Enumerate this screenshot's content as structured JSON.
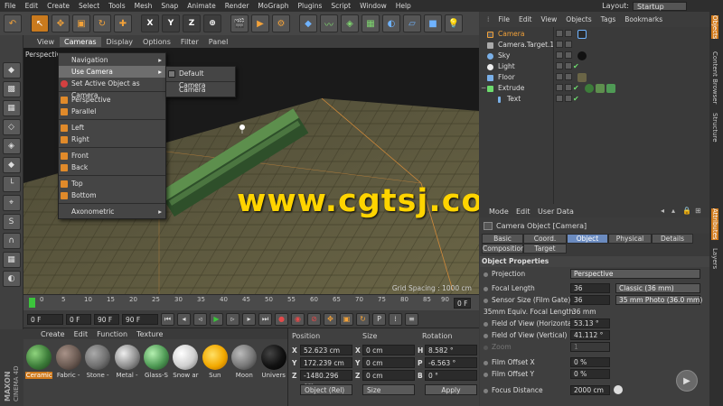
{
  "menubar": {
    "items": [
      "File",
      "Edit",
      "Create",
      "Select",
      "Tools",
      "Mesh",
      "Snap",
      "Animate",
      "Render",
      "MoGraph",
      "Plugins",
      "Script",
      "Window",
      "Help"
    ],
    "layout_label": "Layout:",
    "layout_value": "Startup"
  },
  "viewport": {
    "menu": [
      "View",
      "Cameras",
      "Display",
      "Options",
      "Filter",
      "Panel"
    ],
    "title": "Perspective",
    "grid_spacing": "Grid Spacing : 1000 cm",
    "watermark": "www.cgtsj.com"
  },
  "cameras_menu": {
    "items": [
      "Navigation",
      "Use Camera",
      "Set Active Object as Camera",
      "Perspective",
      "Parallel",
      "Left",
      "Right",
      "Front",
      "Back",
      "Top",
      "Bottom",
      "Axonometric"
    ],
    "submenu": [
      "Default Camera",
      "Camera"
    ]
  },
  "timeline": {
    "ticks": [
      "0",
      "5",
      "10",
      "15",
      "20",
      "25",
      "30",
      "35",
      "40",
      "45",
      "50",
      "55",
      "60",
      "65",
      "70",
      "75",
      "80",
      "85",
      "90"
    ],
    "end_field": "0 F",
    "start": "0 F",
    "current": "0 F",
    "max": "90 F",
    "end": "90 F"
  },
  "materials": {
    "menu": [
      "Create",
      "Edit",
      "Function",
      "Texture"
    ],
    "items": [
      {
        "name": "Ceramic",
        "color": "#3d7d3a"
      },
      {
        "name": "Fabric -",
        "color": "#6a5a52"
      },
      {
        "name": "Stone -",
        "color": "#6f6f6f"
      },
      {
        "name": "Metal -",
        "color": "#8e8e8e"
      },
      {
        "name": "Glass-S",
        "color": "#4f9a55"
      },
      {
        "name": "Snow ar",
        "color": "#cfcfcf"
      },
      {
        "name": "Sun",
        "color": "#f2a900"
      },
      {
        "name": "Moon",
        "color": "#777777"
      },
      {
        "name": "Univers",
        "color": "#111111"
      }
    ],
    "logo_line1": "MAXON",
    "logo_line2": "CINEMA 4D"
  },
  "coords": {
    "headers": [
      "Position",
      "Size",
      "Rotation"
    ],
    "rows": [
      {
        "axis": "X",
        "pos": "52.623 cm",
        "size": "0 cm",
        "rlabel": "H",
        "rot": "8.582 °"
      },
      {
        "axis": "Y",
        "pos": "172.239 cm",
        "size": "0 cm",
        "rlabel": "P",
        "rot": "-6.563 °"
      },
      {
        "axis": "Z",
        "pos": "-1480.296 cm",
        "size": "0 cm",
        "rlabel": "B",
        "rot": "0 °"
      }
    ],
    "mode": "Object (Rel)",
    "size_mode": "Size",
    "apply": "Apply"
  },
  "objects": {
    "menu": [
      "File",
      "Edit",
      "View",
      "Objects",
      "Tags",
      "Bookmarks"
    ],
    "items": [
      {
        "name": "Camera",
        "color": "#f2a23a"
      },
      {
        "name": "Camera.Target.1",
        "color": "#cfcfcf"
      },
      {
        "name": "Sky",
        "color": "#7ab0e8"
      },
      {
        "name": "Light",
        "color": "#e8e8e8"
      },
      {
        "name": "Floor",
        "color": "#7ab0e8"
      },
      {
        "name": "Extrude",
        "color": "#6ddb6d"
      },
      {
        "name": "Text",
        "color": "#7ab0e8"
      }
    ]
  },
  "side_tabs": [
    "Objects",
    "Content Browser",
    "Structure",
    "Attributes",
    "Layers"
  ],
  "attributes": {
    "menu": [
      "Mode",
      "Edit",
      "User Data"
    ],
    "title": "Camera Object [Camera]",
    "tabs": [
      "Basic",
      "Coord.",
      "Object",
      "Physical",
      "Details",
      "Composition",
      "Target"
    ],
    "section": "Object Properties",
    "props": [
      {
        "label": "Projection",
        "value": "Perspective"
      },
      {
        "label": "Focal Length",
        "value": "36",
        "preset": "Classic (36 mm)"
      },
      {
        "label": "Sensor Size (Film Gate)",
        "value": "36",
        "preset": "35 mm Photo (36.0 mm)"
      },
      {
        "label": "35mm Equiv. Focal Length:",
        "value": "36 mm"
      },
      {
        "label": "Field of View (Horizontal)",
        "value": "53.13 °"
      },
      {
        "label": "Field of View (Vertical)",
        "value": "41.112 °"
      },
      {
        "label": "Zoom",
        "value": "1"
      },
      {
        "label": "Film Offset X",
        "value": "0 %"
      },
      {
        "label": "Film Offset Y",
        "value": "0 %"
      },
      {
        "label": "Focus Distance",
        "value": "2000 cm"
      }
    ]
  }
}
